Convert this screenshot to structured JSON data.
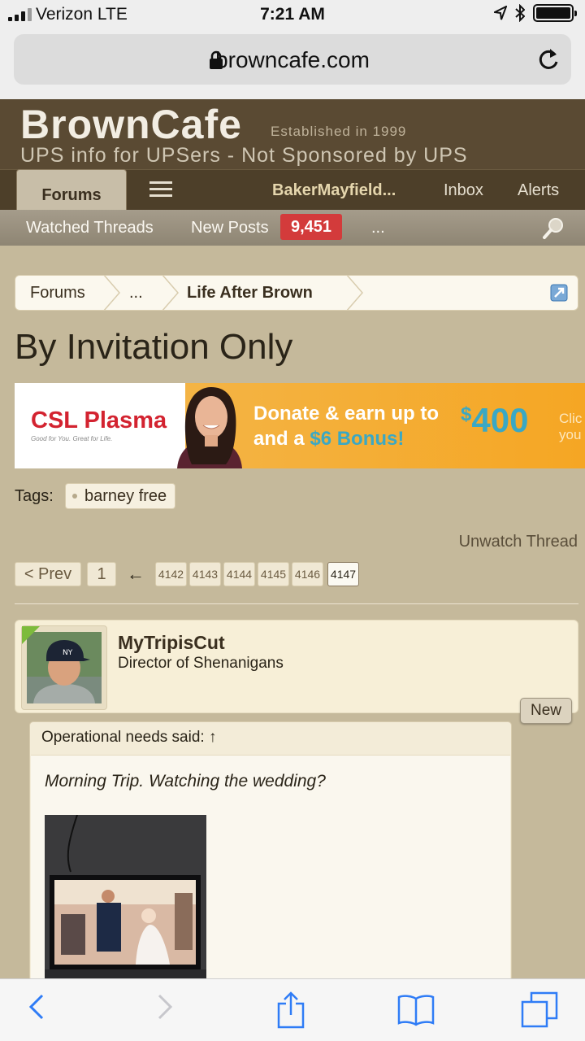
{
  "status_bar": {
    "carrier": "Verizon  LTE",
    "time": "7:21 AM"
  },
  "browser": {
    "url": "browncafe.com"
  },
  "site": {
    "brand": "BrownCafe",
    "established": "Established in 1999",
    "tagline": "UPS info for UPSers - Not Sponsored by UPS"
  },
  "nav": {
    "forums_tab": "Forums",
    "user": "BakerMayfield...",
    "inbox": "Inbox",
    "alerts": "Alerts"
  },
  "subnav": {
    "watched_threads": "Watched Threads",
    "new_posts": "New Posts",
    "new_posts_count": "9,451",
    "more": "..."
  },
  "breadcrumb": {
    "items": [
      "Forums",
      "...",
      "Life After Brown"
    ]
  },
  "thread": {
    "title": "By Invitation Only"
  },
  "ad": {
    "logo": "CSL Plasma",
    "logo_sub": "Good for You. Great for Life.",
    "line1": "Donate & earn up to",
    "amount": "400",
    "line2_prefix": "and a ",
    "line2_bonus": "$6 Bonus!",
    "click_1": "Clic",
    "click_2": "you"
  },
  "tags": {
    "label": "Tags:",
    "items": [
      "barney free"
    ]
  },
  "unwatch": "Unwatch Thread",
  "pagination": {
    "prev": "< Prev",
    "first": "1",
    "arrow": "←",
    "pages": [
      "4142",
      "4143",
      "4144",
      "4145",
      "4146"
    ],
    "current": "4147"
  },
  "post": {
    "username": "MyTripisCut",
    "rank": "Director of Shenanigans",
    "new_badge": "New",
    "quote": {
      "head": "Operational needs said: ↑",
      "text": "Morning Trip. Watching the wedding?"
    }
  },
  "colors": {
    "accent_red": "#d33b3b",
    "header_brown": "#5a4a33",
    "page_bg": "#c5b99b",
    "ios_blue": "#2f7cf6"
  }
}
